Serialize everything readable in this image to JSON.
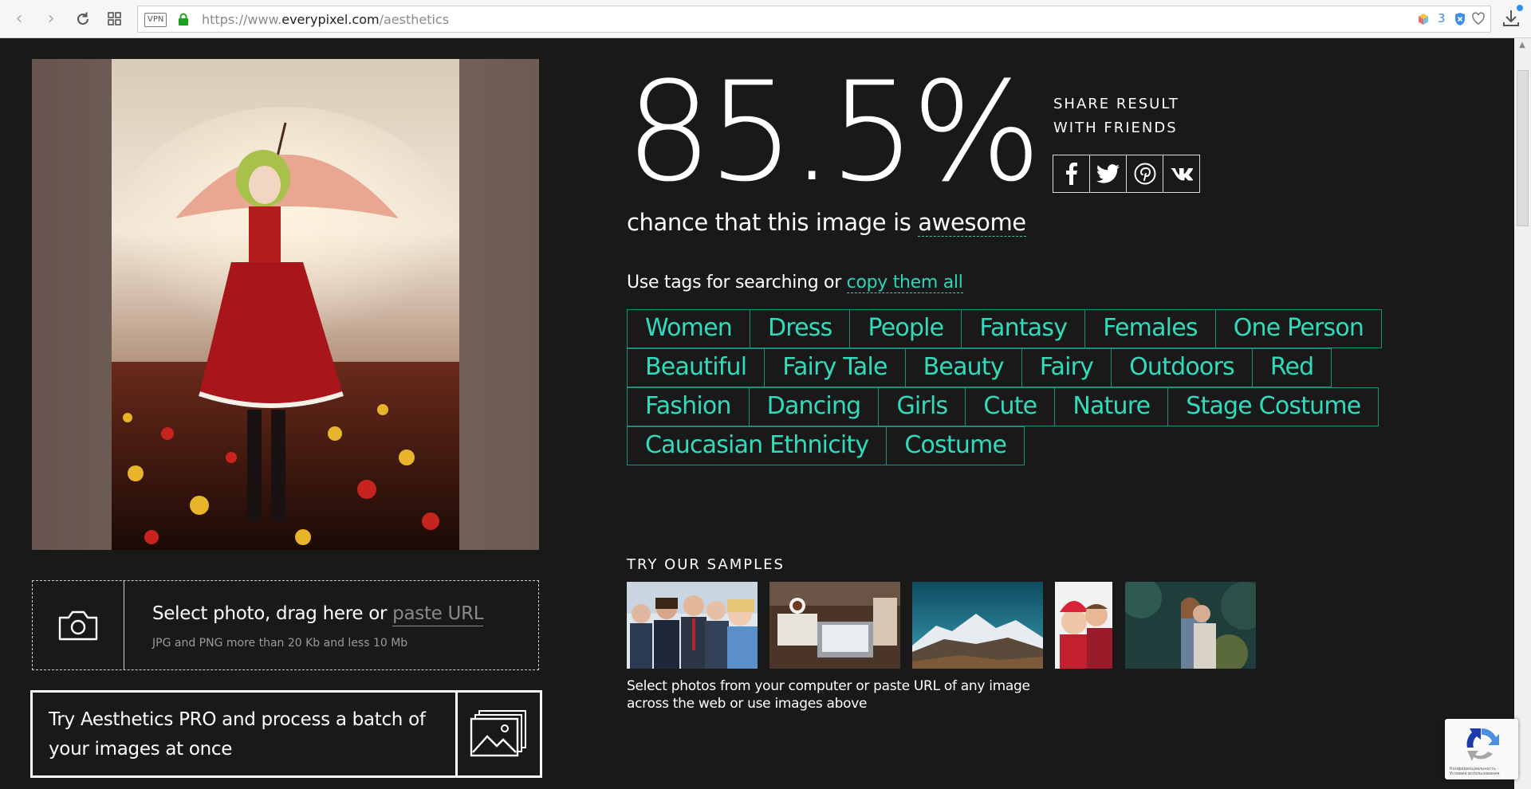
{
  "browser": {
    "vpn_label": "VPN",
    "url_prefix": "https://www.",
    "url_domain": "everypixel.com",
    "url_path": "/aesthetics",
    "extension_count": "3"
  },
  "result": {
    "score": "85.5%",
    "chance_prefix": "chance that this image is ",
    "verdict": "awesome"
  },
  "share": {
    "title": "SHARE RESULT\nWITH FRIENDS",
    "networks": [
      "facebook-icon",
      "twitter-icon",
      "pinterest-icon",
      "vk-icon"
    ]
  },
  "tags_section": {
    "intro": "Use tags for searching or ",
    "copy_link": "copy them all",
    "rows": [
      [
        "Women",
        "Dress",
        "People",
        "Fantasy",
        "Females",
        "One Person"
      ],
      [
        "Beautiful",
        "Fairy Tale",
        "Beauty",
        "Fairy",
        "Outdoors",
        "Red"
      ],
      [
        "Fashion",
        "Dancing",
        "Girls",
        "Cute",
        "Nature",
        "Stage Costume"
      ],
      [
        "Caucasian Ethnicity",
        "Costume"
      ]
    ]
  },
  "upload": {
    "main_text": "Select photo, drag here or ",
    "paste_placeholder": "paste URL",
    "hint": "JPG and PNG more than 20 Kb and less 10 Mb"
  },
  "pro": {
    "text": "Try Aesthetics PRO and process a batch of your images at once"
  },
  "samples": {
    "title": "TRY OUR SAMPLES",
    "hint": "Select photos from your computer or paste URL of any image across the web or use images above"
  },
  "recaptcha": {
    "footer": "Конфиденциальность - Условия использования"
  },
  "colors": {
    "background": "#191919",
    "tag_text": "#31dbbb",
    "tag_border": "#1f8f7c",
    "link": "#2fd4b6"
  }
}
